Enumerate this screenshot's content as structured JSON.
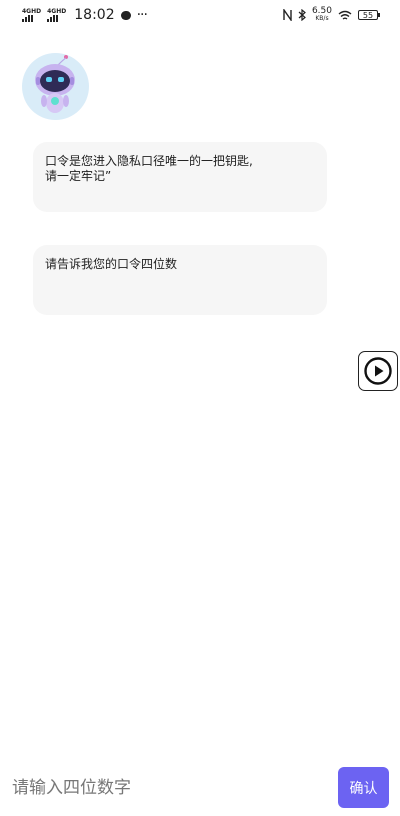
{
  "status_bar": {
    "network1": "4G",
    "network1_sup": "HD",
    "network2": "4G",
    "network2_sup": "HD",
    "time": "18:02",
    "more": "···",
    "net_speed": "6.50",
    "net_unit": "KB/s",
    "battery": "55"
  },
  "chat": {
    "messages": [
      {
        "lines": [
          "口令是您进入隐私口径唯一的一把钥匙,",
          "请一定牢记”"
        ]
      },
      {
        "lines": [
          "请告诉我您的口令四位数"
        ]
      }
    ]
  },
  "input": {
    "placeholder": "请输入四位数字",
    "value": "",
    "confirm_label": "确认"
  },
  "colors": {
    "accent": "#6c63f2",
    "bubble_bg": "#f6f6f6",
    "avatar_bg": "#d9ecf8"
  },
  "icons": [
    "nfc-icon",
    "bluetooth-icon",
    "wifi-icon",
    "battery-icon",
    "play-icon",
    "robot-avatar"
  ]
}
